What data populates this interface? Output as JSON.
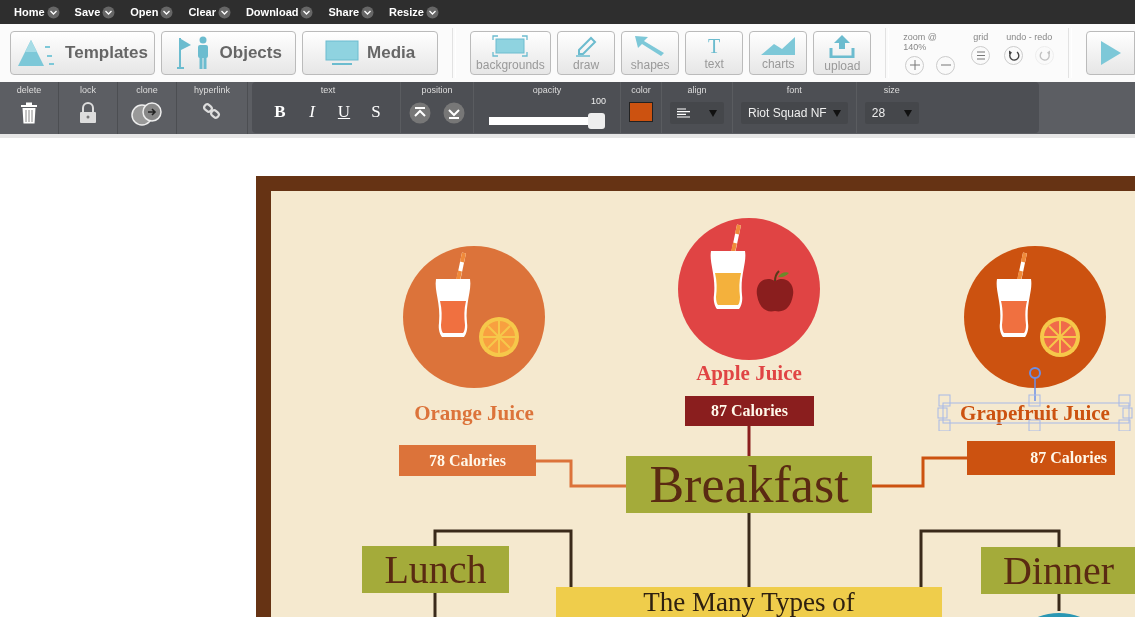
{
  "menu": [
    {
      "label": "Home"
    },
    {
      "label": "Save"
    },
    {
      "label": "Open"
    },
    {
      "label": "Clear"
    },
    {
      "label": "Download"
    },
    {
      "label": "Share"
    },
    {
      "label": "Resize"
    }
  ],
  "main_buttons": [
    {
      "label": "Templates",
      "kind": "pyramid"
    },
    {
      "label": "Objects",
      "kind": "figures"
    },
    {
      "label": "Media",
      "kind": "screen"
    }
  ],
  "tools": [
    {
      "label": "backgrounds",
      "kind": "frame"
    },
    {
      "label": "draw",
      "kind": "pencil"
    },
    {
      "label": "shapes",
      "kind": "arrow"
    },
    {
      "label": "text",
      "kind": "glyph",
      "glyph": "T"
    },
    {
      "label": "charts",
      "kind": "area"
    },
    {
      "label": "upload",
      "kind": "upload"
    }
  ],
  "view": {
    "zoom_label": "zoom @ 140%",
    "grid_label": "grid",
    "history_label": "undo - redo",
    "undo_disabled": false,
    "redo_disabled": true
  },
  "properties": {
    "delete_label": "delete",
    "lock_label": "lock",
    "clone_label": "clone",
    "hyperlink_label": "hyperlink",
    "text_label": "text",
    "styles": [
      {
        "glyph": "B",
        "kind": "bold"
      },
      {
        "glyph": "I",
        "kind": "italic"
      },
      {
        "glyph": "U",
        "kind": "underline"
      },
      {
        "glyph": "S",
        "kind": "plain"
      }
    ],
    "position_label": "position",
    "opacity_label": "opacity",
    "opacity_value": "100",
    "opacity": {
      "level": 1
    },
    "color_label": "color",
    "swatch": {
      "color": "#cc5210"
    },
    "align_label": "align",
    "font_label": "font",
    "font_value": "Riot Squad NF",
    "size_label": "size",
    "size_value": "28"
  },
  "canvas": {
    "juices": [
      {
        "name": "Orange Juice",
        "color": "#dc733a",
        "tag": {
          "calories": "78 Calories",
          "color": "#dc733a"
        },
        "kind": "citrus",
        "selected": false
      },
      {
        "name": "Apple Juice",
        "color": "#e04444",
        "tag": {
          "calories": "87 Calories",
          "color": "#8a1e1e"
        },
        "kind": "apple",
        "selected": false
      },
      {
        "name": "Grapefruit Juice",
        "color": "#cc5210",
        "tag": {
          "calories": "87 Calories",
          "color": "#cc5210"
        },
        "kind": "citrus",
        "selected": true
      }
    ],
    "meals": [
      {
        "name": "Breakfast"
      },
      {
        "name": "Lunch"
      },
      {
        "name": "Dinner"
      }
    ],
    "title": "The Many Types of"
  }
}
